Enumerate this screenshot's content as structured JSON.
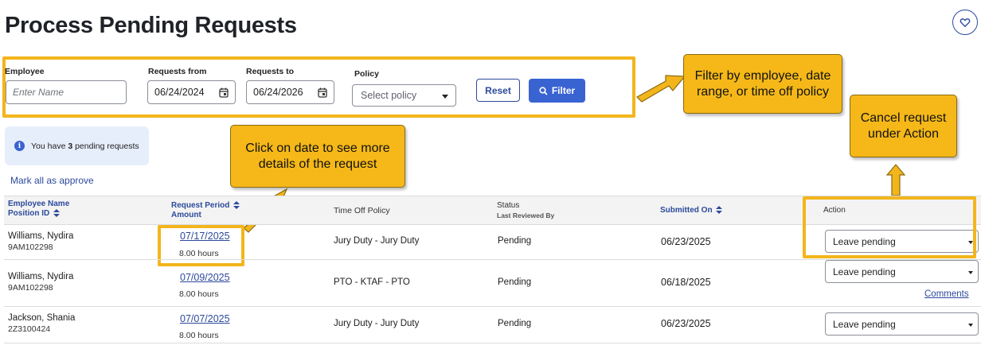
{
  "page": {
    "title": "Process Pending Requests"
  },
  "favorite": {
    "icon": "heart-icon"
  },
  "filters": {
    "employee_label": "Employee",
    "employee_placeholder": "Enter Name",
    "from_label": "Requests from",
    "from_value": "06/24/2024",
    "to_label": "Requests to",
    "to_value": "06/24/2026",
    "policy_label": "Policy",
    "policy_value": "Select policy",
    "reset_label": "Reset",
    "filter_label": "Filter"
  },
  "callouts": {
    "filter": "Filter by employee, date range, or time off policy",
    "date": "Click on date to see more details of the request",
    "cancel": "Cancel request under Action"
  },
  "info": {
    "prefix": "You have ",
    "count": "3",
    "suffix": " pending requests"
  },
  "mark_all": "Mark all as approve",
  "table": {
    "headers": {
      "employee": "Employee Name",
      "position": "Position ID",
      "period": "Request Period",
      "amount": "Amount",
      "policy": "Time Off Policy",
      "status": "Status",
      "reviewed": "Last Reviewed By",
      "submitted": "Submitted On",
      "action": "Action"
    },
    "rows": [
      {
        "name": "Williams, Nydira",
        "position": "9AM102298",
        "date": "07/17/2025",
        "hours": "8.00 hours",
        "policy": "Jury Duty - Jury Duty",
        "status": "Pending",
        "submitted": "06/23/2025",
        "action": "Leave pending"
      },
      {
        "name": "Williams, Nydira",
        "position": "9AM102298",
        "date": "07/09/2025",
        "hours": "8.00 hours",
        "policy": "PTO - KTAF - PTO",
        "status": "Pending",
        "submitted": "06/18/2025",
        "action": "Leave pending"
      },
      {
        "name": "Jackson, Shania",
        "position": "2Z3100424",
        "date": "07/07/2025",
        "hours": "8.00 hours",
        "policy": "Jury Duty - Jury Duty",
        "status": "Pending",
        "submitted": "06/23/2025",
        "action": "Leave pending"
      }
    ],
    "comments_label": "Comments"
  },
  "colors": {
    "highlight": "#f2b51c",
    "callout_fill": "#f5b818",
    "link": "#2c4a9b",
    "primary_button": "#3a63d2"
  }
}
